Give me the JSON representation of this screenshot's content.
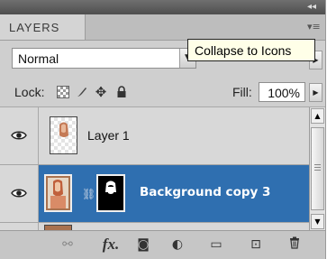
{
  "panel": {
    "tab_label": "LAYERS",
    "collapse_glyph": "◂◂",
    "menu_glyph": "▾≡",
    "blend_mode": "Normal",
    "tooltip": "Collapse to Icons",
    "lock_label": "Lock:",
    "fill_label": "Fill:",
    "fill_value": "100%"
  },
  "layers": [
    {
      "name": "Layer 1",
      "visible": true,
      "selected": false
    },
    {
      "name": "Background copy 3",
      "visible": true,
      "selected": true
    }
  ],
  "icons": {
    "lock_transparent": "checker-icon",
    "lock_pixels": "brush-icon",
    "lock_position": "move-icon",
    "lock_all": "padlock-icon",
    "bottom": [
      "link-icon",
      "fx-icon",
      "add-mask-icon",
      "adjustment-icon",
      "folder-icon",
      "new-layer-icon",
      "trash-icon"
    ]
  },
  "glyphs": {
    "dropdown": "▼",
    "right_arrow": "▶",
    "up": "▲",
    "down": "▼",
    "pixels": "🖌",
    "move": "✥",
    "lock": "🔒",
    "chain": "⛓",
    "link": "⚯",
    "fx": "fx.",
    "mask": "◙",
    "adjust": "◐",
    "group": "▭",
    "new": "⊡",
    "trash": "🗑"
  },
  "colors": {
    "selected_row": "#2f6fb0",
    "tooltip_bg": "#ffffe8"
  }
}
